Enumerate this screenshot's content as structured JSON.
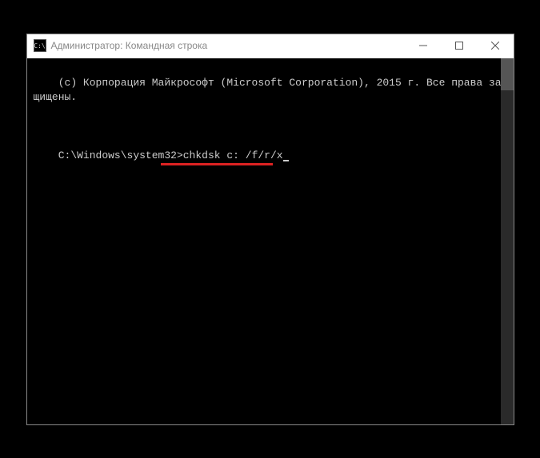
{
  "window": {
    "title": "Администратор: Командная строка",
    "icon_label": "C:\\"
  },
  "console": {
    "copyright": "(c) Корпорация Майкрософт (Microsoft Corporation), 2015 г. Все права защищены.",
    "blank": "",
    "prompt": "C:\\Windows\\system32>",
    "command": "chkdsk c: /f/r/x"
  }
}
